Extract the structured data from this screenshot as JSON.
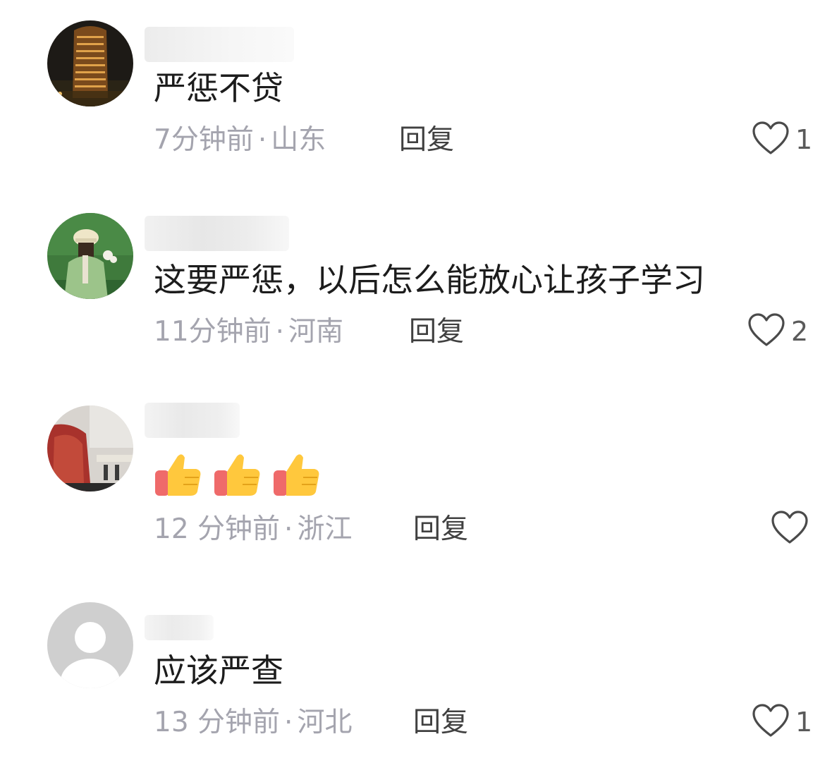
{
  "comments": [
    {
      "text": "严惩不贷",
      "time": "7分钟前",
      "separator": "·",
      "location": "山东",
      "reply_label": "回复",
      "likes": "1"
    },
    {
      "text": "这要严惩，以后怎么能放心让孩子学习",
      "time": "11分钟前",
      "separator": "·",
      "location": "河南",
      "reply_label": "回复",
      "likes": "2"
    },
    {
      "text": "",
      "emoji": [
        "thumbs-up",
        "thumbs-up",
        "thumbs-up"
      ],
      "time": "12 分钟前",
      "separator": "·",
      "location": "浙江",
      "reply_label": "回复",
      "likes": ""
    },
    {
      "text": "应该严查",
      "time": "13 分钟前",
      "separator": "·",
      "location": "河北",
      "reply_label": "回复",
      "likes": "1"
    }
  ],
  "icons": {
    "like": "heart-outline-icon",
    "reaction": "thumbs-up-icon"
  },
  "colors": {
    "text": "#1c1c1c",
    "meta": "#a4a4ae",
    "reply": "#404040",
    "heart": "#4a4a4a",
    "thumb_yellow": "#ffc83d",
    "thumb_cuff": "#ef6a6a"
  }
}
